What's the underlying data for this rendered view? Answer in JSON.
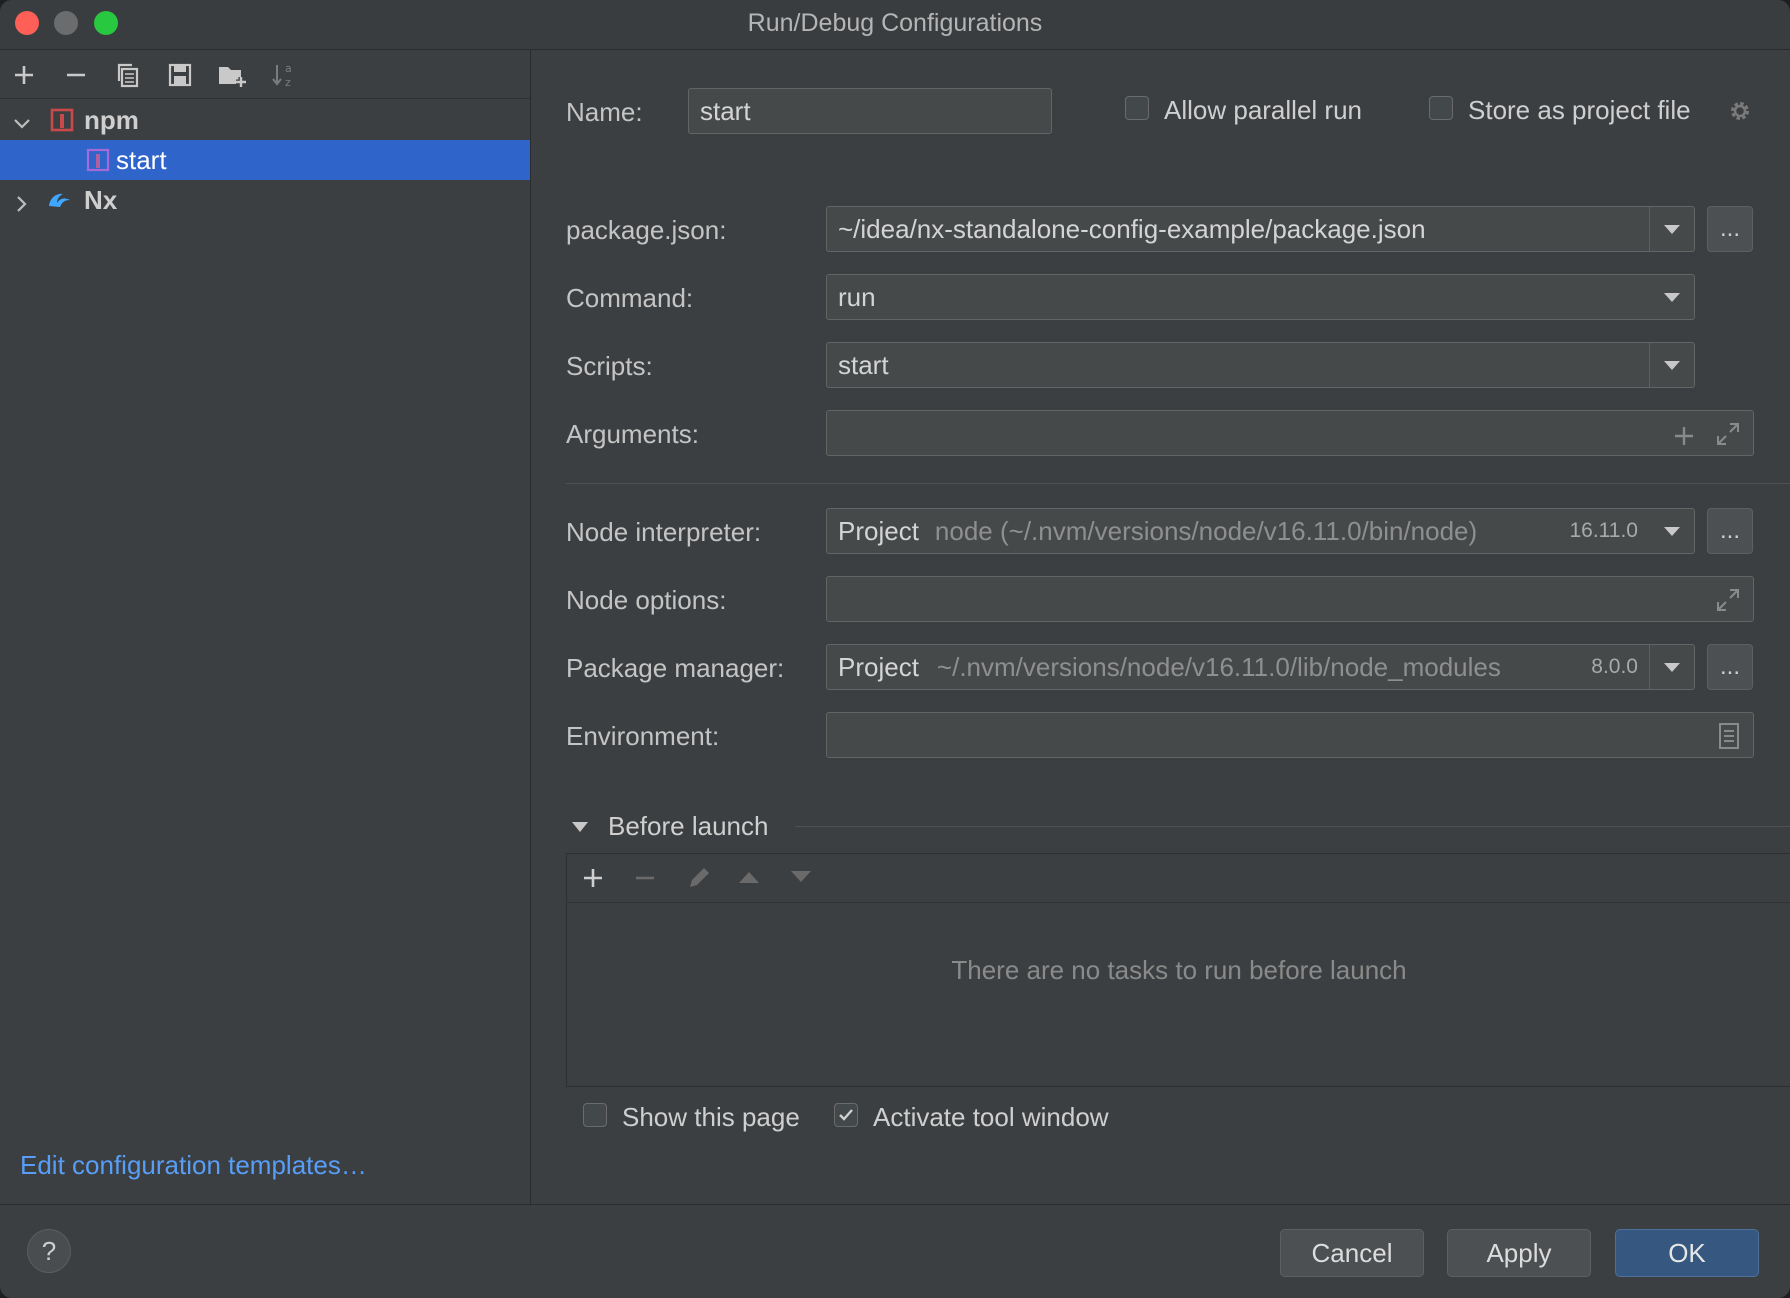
{
  "window": {
    "title": "Run/Debug Configurations"
  },
  "toolbar": {
    "icons": [
      "plus-icon",
      "minus-icon",
      "copy-icon",
      "save-icon",
      "new-folder-icon",
      "sort-alphabetically-icon"
    ]
  },
  "tree": {
    "groups": [
      {
        "label": "npm",
        "expanded": true,
        "icon": "npm-icon",
        "icon_color": "#c94a4a",
        "children": [
          {
            "label": "start",
            "selected": true
          }
        ]
      },
      {
        "label": "Nx",
        "expanded": false,
        "icon": "nx-icon",
        "icon_color": "#3fa7ff"
      }
    ]
  },
  "edit_templates_link": "Edit configuration templates…",
  "form": {
    "name_label": "Name:",
    "name_value": "start",
    "allow_parallel_label": "Allow parallel run",
    "allow_parallel_checked": false,
    "store_project_label": "Store as project file",
    "store_project_checked": false,
    "package_json_label": "package.json:",
    "package_json_value": "~/idea/nx-standalone-config-example/package.json",
    "command_label": "Command:",
    "command_value": "run",
    "scripts_label": "Scripts:",
    "scripts_value": "start",
    "arguments_label": "Arguments:",
    "arguments_value": "",
    "node_interpreter_label": "Node interpreter:",
    "node_interpreter_prefix": "Project",
    "node_interpreter_path": "node (~/.nvm/versions/node/v16.11.0/bin/node)",
    "node_interpreter_version": "16.11.0",
    "node_options_label": "Node options:",
    "node_options_value": "",
    "package_manager_label": "Package manager:",
    "package_manager_prefix": "Project",
    "package_manager_path": "~/.nvm/versions/node/v16.11.0/lib/node_modules",
    "package_manager_version": "8.0.0",
    "environment_label": "Environment:",
    "environment_value": "",
    "dots_label": "..."
  },
  "before_launch": {
    "title": "Before launch",
    "empty_text": "There are no tasks to run before launch",
    "tools": [
      "plus-icon",
      "minus-icon",
      "edit-icon",
      "move-up-icon",
      "move-down-icon"
    ]
  },
  "options": {
    "show_page_label": "Show this page",
    "show_page_checked": false,
    "activate_tool_label": "Activate tool window",
    "activate_tool_checked": true
  },
  "buttons": {
    "help": "?",
    "cancel": "Cancel",
    "apply": "Apply",
    "ok": "OK"
  },
  "colors": {
    "selection": "#2f65ca",
    "link": "#589df6",
    "ok_button": "#365880"
  }
}
